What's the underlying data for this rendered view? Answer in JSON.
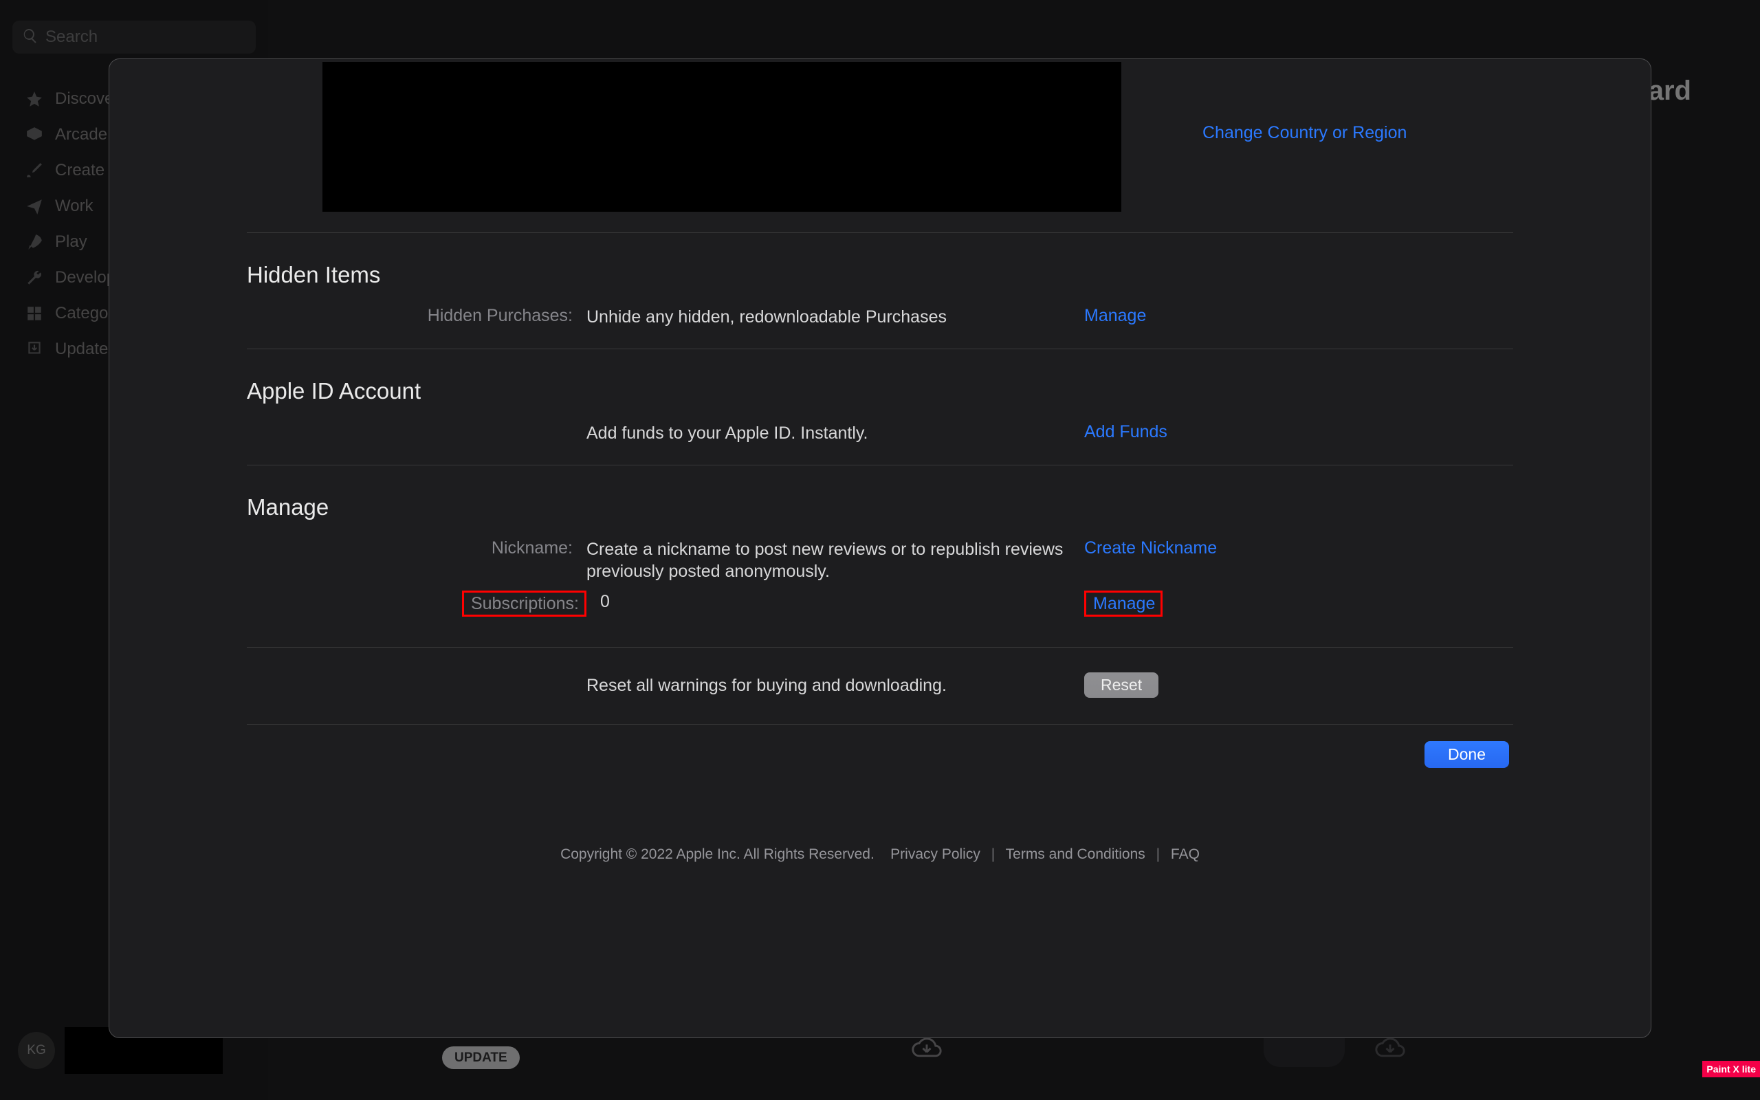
{
  "search": {
    "placeholder": "Search"
  },
  "sidebar": {
    "items": [
      {
        "label": "Discover"
      },
      {
        "label": "Arcade"
      },
      {
        "label": "Create"
      },
      {
        "label": "Work"
      },
      {
        "label": "Play"
      },
      {
        "label": "Develop"
      },
      {
        "label": "Categories"
      },
      {
        "label": "Updates"
      }
    ]
  },
  "user": {
    "initials": "KG"
  },
  "bg_header_fragment": "t Card",
  "bg_update_badge": "UPDATE",
  "modal": {
    "top_link": "Change Country or Region",
    "sections": {
      "hidden": {
        "title": "Hidden Items",
        "row_label": "Hidden Purchases:",
        "row_desc": "Unhide any hidden, redownloadable Purchases",
        "action": "Manage"
      },
      "apple_id": {
        "title": "Apple ID Account",
        "row_desc": "Add funds to your Apple ID. Instantly.",
        "action": "Add Funds"
      },
      "manage": {
        "title": "Manage",
        "nickname": {
          "label": "Nickname:",
          "desc": "Create a nickname to post new reviews or to republish reviews previously posted anonymously.",
          "action": "Create Nickname"
        },
        "subscriptions": {
          "label": "Subscriptions:",
          "value": "0",
          "action": "Manage"
        }
      },
      "reset": {
        "desc": "Reset all warnings for buying and downloading.",
        "button": "Reset"
      }
    },
    "done": "Done",
    "footer": {
      "copyright": "Copyright © 2022 Apple Inc. All Rights Reserved.",
      "privacy": "Privacy Policy",
      "terms": "Terms and Conditions",
      "faq": "FAQ"
    }
  },
  "corner_badge": "Paint X lite"
}
